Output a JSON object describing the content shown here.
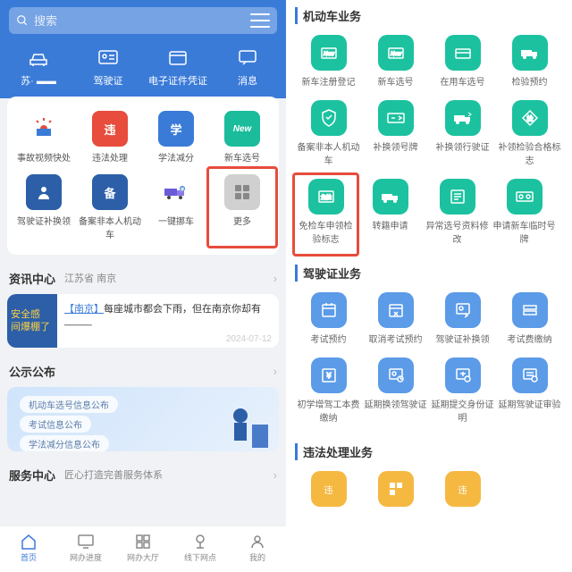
{
  "search": {
    "placeholder": "搜索"
  },
  "top": [
    {
      "label": "苏· ▬▬"
    },
    {
      "label": "驾驶证"
    },
    {
      "label": "电子证件凭证"
    },
    {
      "label": "消息"
    }
  ],
  "grid1": [
    "事故视频快处",
    "违法处理",
    "学法减分",
    "新车选号",
    "驾驶证补换领",
    "备案非本人机动车",
    "一键挪车",
    "更多"
  ],
  "info": {
    "title": "资讯中心",
    "sub": "江苏省 南京"
  },
  "news": {
    "banner": "安全感\n间爆棚了",
    "title": "【南京】",
    "body": "每座城市都会下雨，但在南京你却有_____",
    "date": "2024-07-12"
  },
  "pub": {
    "title": "公示公布",
    "tags": [
      "机动车选号信息公布",
      "考试信息公布",
      "学法减分信息公布"
    ]
  },
  "svc": {
    "title": "服务中心",
    "sub": "匠心打造完善服务体系"
  },
  "tabs": [
    "首页",
    "网办进度",
    "网办大厅",
    "线下网点",
    "我的"
  ],
  "rsec1": {
    "title": "机动车业务",
    "items": [
      "新车注册登记",
      "新车选号",
      "在用车选号",
      "检验预约",
      "备案非本人机动车",
      "补换领号牌",
      "补换领行驶证",
      "补领检验合格标志",
      "免检车申领检验标志",
      "转籍申请",
      "异常选号资料修改",
      "申请新车临时号牌"
    ]
  },
  "rsec2": {
    "title": "驾驶证业务",
    "items": [
      "考试预约",
      "取消考试预约",
      "驾驶证补换领",
      "考试费缴纳",
      "初学增驾工本费缴纳",
      "延期换领驾驶证",
      "延期提交身份证明",
      "延期驾驶证审验"
    ]
  },
  "rsec3": {
    "title": "违法处理业务"
  }
}
